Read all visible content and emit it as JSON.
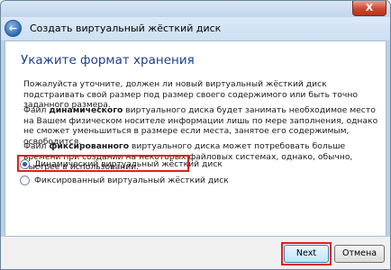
{
  "window": {
    "title": "Создать виртуальный жёсткий диск",
    "close_glyph": "X",
    "back_glyph": "←"
  },
  "page": {
    "heading": "Укажите формат хранения",
    "intro": "Пожалуйста уточните, должен ли новый виртуальный жёсткий диск подстраивать свой размер под размер своего содержимого или быть точно заданного размера.",
    "dynamic_para": {
      "prefix": "Файл ",
      "bold": "динамического",
      "rest": " виртуального диска будет занимать необходимое место на Вашем физическом носителе информации лишь по мере заполнения, однако не сможет уменьшиться в размере если места, занятое его содержимым, освободится."
    },
    "fixed_para": {
      "prefix": "Файл ",
      "bold": "фиксированного",
      "rest": " виртуального диска может потребовать больше времени при создании на некоторых файловых системах, однако, обычно, быстрее в использовании."
    }
  },
  "options": [
    {
      "label": "Динамический виртуальный жёсткий диск",
      "checked": true
    },
    {
      "label": "Фиксированный виртуальный жёсткий диск",
      "checked": false
    }
  ],
  "footer": {
    "next_label": "Next",
    "cancel_label": "Отмена"
  },
  "colors": {
    "heading": "#1e3f8a",
    "highlight": "#e0201c",
    "window_frame": "#b9d1ea"
  }
}
